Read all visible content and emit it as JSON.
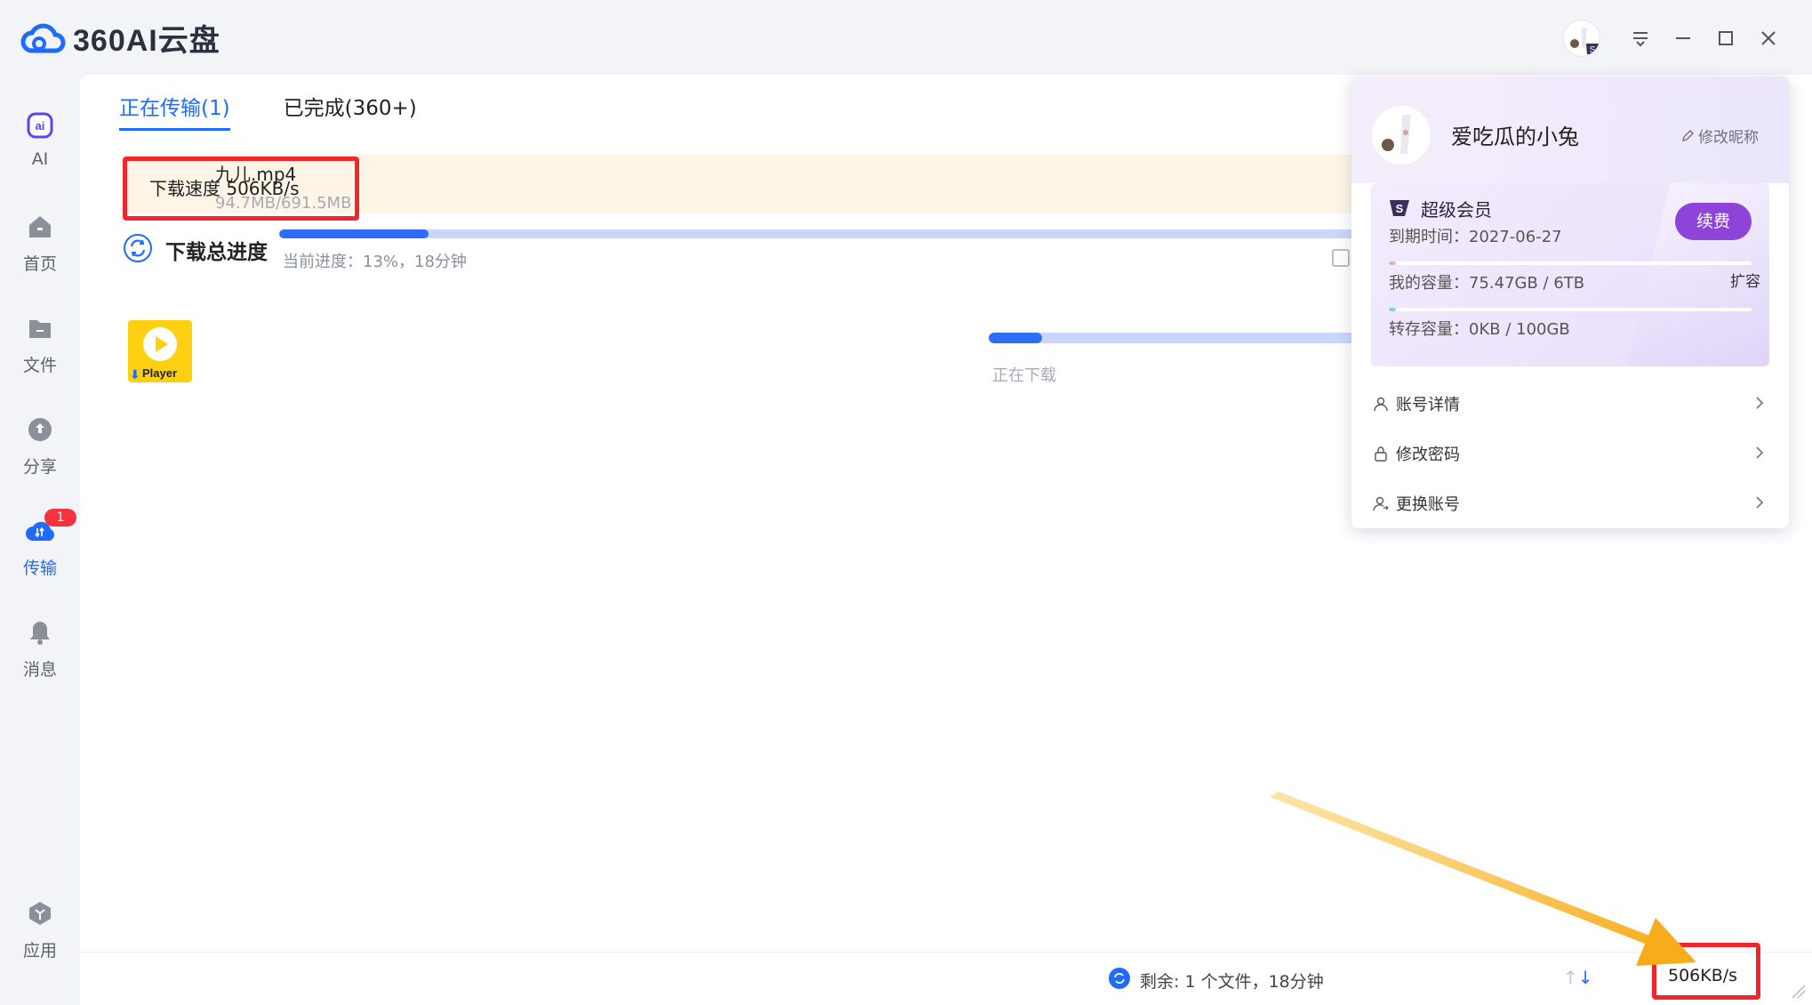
{
  "app": {
    "logo_text": "360AI云盘"
  },
  "sidebar": {
    "items": [
      {
        "label": "AI",
        "icon": "ai-icon"
      },
      {
        "label": "首页",
        "icon": "home-icon"
      },
      {
        "label": "文件",
        "icon": "folder-icon"
      },
      {
        "label": "分享",
        "icon": "share-icon"
      },
      {
        "label": "传输",
        "icon": "transfer-icon",
        "badge": "1",
        "active": true
      },
      {
        "label": "消息",
        "icon": "bell-icon"
      },
      {
        "label": "应用",
        "icon": "apps-icon"
      }
    ]
  },
  "tabs": [
    {
      "label": "正在传输(1)",
      "active": true
    },
    {
      "label": "已完成(360+)",
      "active": false
    }
  ],
  "speed_banner": {
    "label": "下载速度  506KB/s"
  },
  "total": {
    "title": "下载总进度",
    "subtitle": "当前进度：13%，18分钟",
    "progress": 0.13
  },
  "file": {
    "name": "九儿.mp4",
    "size": "94.7MB/691.5MB",
    "status": "正在下载",
    "progress": 0.12,
    "thumb_label": "Player"
  },
  "footer": {
    "remaining": "剩余: 1 个文件，18分钟",
    "speed": "506KB/s"
  },
  "profile": {
    "name": "爱吃瓜的小兔",
    "edit_label": "修改昵称",
    "vip_title": "超级会员",
    "expire": "到期时间：2027-06-27",
    "renew_label": "续费",
    "capacity_text": "我的容量：75.47GB / 6TB",
    "capacity_used": 0.012,
    "expand_label": "扩容",
    "transfer_text": "转存容量：0KB / 100GB",
    "transfer_used": 0.02,
    "menu": [
      {
        "label": "账号详情",
        "icon": "user-icon"
      },
      {
        "label": "修改密码",
        "icon": "lock-icon"
      },
      {
        "label": "更换账号",
        "icon": "switch-user-icon"
      }
    ]
  },
  "colors": {
    "accent": "#1f6bff",
    "highlight_box": "#f0262d",
    "vip_purple": "#8c45d8",
    "annotation_arrow": "#f7b52c"
  }
}
